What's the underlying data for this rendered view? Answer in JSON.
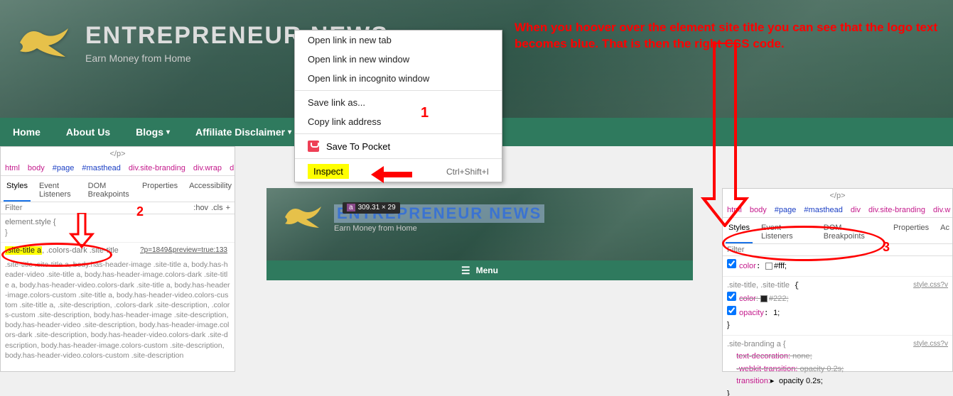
{
  "site": {
    "title": "ENTREPRENEUR NEWS",
    "tagline": "Earn Money from Home",
    "nav": [
      {
        "label": "Home"
      },
      {
        "label": "About Us"
      },
      {
        "label": "Blogs",
        "dd": true
      },
      {
        "label": "Affiliate Disclaimer",
        "dd": true
      }
    ]
  },
  "ctx": {
    "items_top": [
      "Open link in new tab",
      "Open link in new window",
      "Open link in incognito window"
    ],
    "items_mid": [
      "Save link as...",
      "Copy link address"
    ],
    "pocket": "Save To Pocket",
    "inspect": "Inspect",
    "shortcut": "Ctrl+Shift+I"
  },
  "dev_left": {
    "closing": "</p>",
    "breadcrumb": [
      "html",
      "body",
      "#page",
      "#masthead",
      "div.site-branding",
      "div.wrap",
      "div.site-brand"
    ],
    "tabs": [
      "Styles",
      "Event Listeners",
      "DOM Breakpoints",
      "Properties",
      "Accessibility"
    ],
    "filter": "Filter",
    "hov": ":hov",
    "cls": ".cls",
    "element_style": "element.style {",
    "hl_selector": ".site-title a",
    "selector_suffix": ", .colors-dark .site-title",
    "source_link": "?p=1849&preview=true:133",
    "long_css": ".site-title .site-title a, body.has-header-image .site-title a, body.has-header-video .site-title a, body.has-header-image.colors-dark .site-title a, body.has-header-video.colors-dark .site-title a, body.has-header-image.colors-custom .site-title a, body.has-header-video.colors-custom .site-title a, .site-description, .colors-dark .site-description, .colors-custom .site-description, body.has-header-image .site-description, body.has-header-video .site-description, body.has-header-image.colors-dark .site-description, body.has-header-video.colors-dark .site-description, body.has-header-image.colors-custom .site-description, body.has-header-video.colors-custom .site-description"
  },
  "mini": {
    "title": "ENTREPRENEUR NEWS",
    "tagline": "Earn Money from Home",
    "menu": "Menu",
    "dim": "309.31 × 29"
  },
  "dev_right": {
    "closing": "</p>",
    "breadcrumb": [
      "html",
      "body",
      "#page",
      "#masthead",
      "div",
      "div.site-branding",
      "div.w"
    ],
    "tabs": [
      "Styles",
      "Event Listeners",
      "DOM Breakpoints",
      "Properties",
      "Ac"
    ],
    "filter": "Filter",
    "rule1_prop": "color",
    "rule1_val": "#fff;",
    "rule2_sel": ".site-title, .site-title",
    "rule2_src": "style.css?v",
    "rule2_prop1": "color",
    "rule2_val1": "#222;",
    "rule2_prop2": "opacity",
    "rule2_val2": "1;",
    "rule3_sel": ".site-branding a {",
    "rule3_src": "style.css?v",
    "rule3_p1": "text-decoration:",
    "rule3_v1": "none;",
    "rule3_p2": "-webkit-transition:",
    "rule3_v2": "opacity 0.2s;",
    "rule3_p3": "transition:",
    "rule3_v3": "opacity 0.2s;",
    "close": "}"
  },
  "annotations": {
    "n1": "1",
    "n2": "2",
    "n3": "3",
    "text": "When you hoover over the element site title you can see that the logo text becomes blue. That is then the right CSS code."
  }
}
